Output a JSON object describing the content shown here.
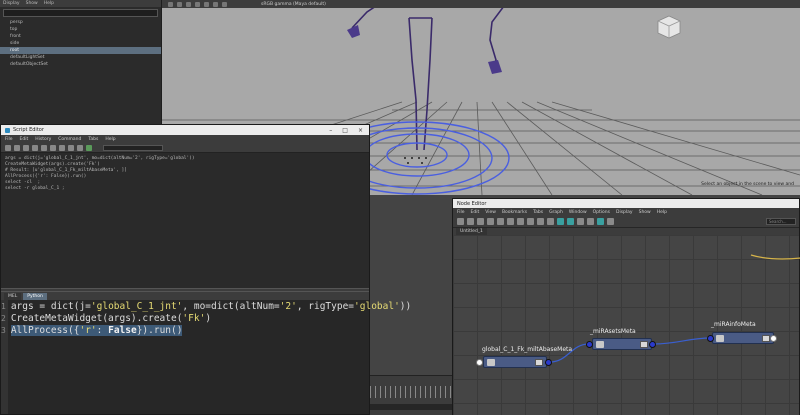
{
  "outliner": {
    "menu": [
      "Display",
      "Show",
      "Help"
    ],
    "items": [
      "persp",
      "top",
      "front",
      "side",
      "root",
      "defaultLightSet",
      "defaultObjectSet"
    ],
    "selected_index": 4
  },
  "viewport": {
    "camera_label": "persp",
    "toolbar_text": "sRGB gamma (Maya default)",
    "hint": "Select an object in the scene to view and"
  },
  "script_editor": {
    "title": "Script Editor",
    "menu": [
      "File",
      "Edit",
      "History",
      "Command",
      "Tabs",
      "Help"
    ],
    "history": [
      "args = dict(j='global_C_1_jnt', mo=dict(altNum='2', rigType='global'))",
      "CreateMetaWidget(args).create('Fk')",
      "# Result: [u'global_C_1_Fk_miltAbaseMeta', ]]",
      "AllProcess({'r': False}).run()",
      "select -cl  ;",
      "select -r global_C_1 ;"
    ],
    "tabs": [
      "MEL",
      "Python"
    ],
    "active_tab": "Python",
    "line_numbers": [
      "1",
      "2",
      "3"
    ],
    "code": {
      "line1_a": "args = dict(j=",
      "line1_s1": "'global_C_1_jnt'",
      "line1_b": ", mo=dict(altNum=",
      "line1_s2": "'2'",
      "line1_c": ", rigType=",
      "line1_s3": "'global'",
      "line1_d": "))",
      "line2_a": "CreateMetaWidget(args).create(",
      "line2_s1": "'Fk'",
      "line2_b": ")",
      "line3_a": "AllProcess({",
      "line3_s1": "'r'",
      "line3_b": ": ",
      "line3_kw": "False",
      "line3_c": "}).run()"
    }
  },
  "timeline": {
    "frame_label": "1"
  },
  "node_editor": {
    "title": "Node Editor",
    "menu": [
      "File",
      "Edit",
      "View",
      "Bookmarks",
      "Tabs",
      "Graph",
      "Window",
      "Options",
      "Display",
      "Show",
      "Help"
    ],
    "tab": "Untitled_1",
    "search_placeholder": "Search...",
    "nodes": [
      {
        "label": "global_C_1_Fk_miltAbaseMeta"
      },
      {
        "label": "_miRAsetsMeta"
      },
      {
        "label": "_miRAinfoMeta"
      }
    ]
  },
  "colors": {
    "node_fill": "#4a5b85",
    "port_blue": "#2a3acb",
    "selection": "#3d5a77"
  }
}
